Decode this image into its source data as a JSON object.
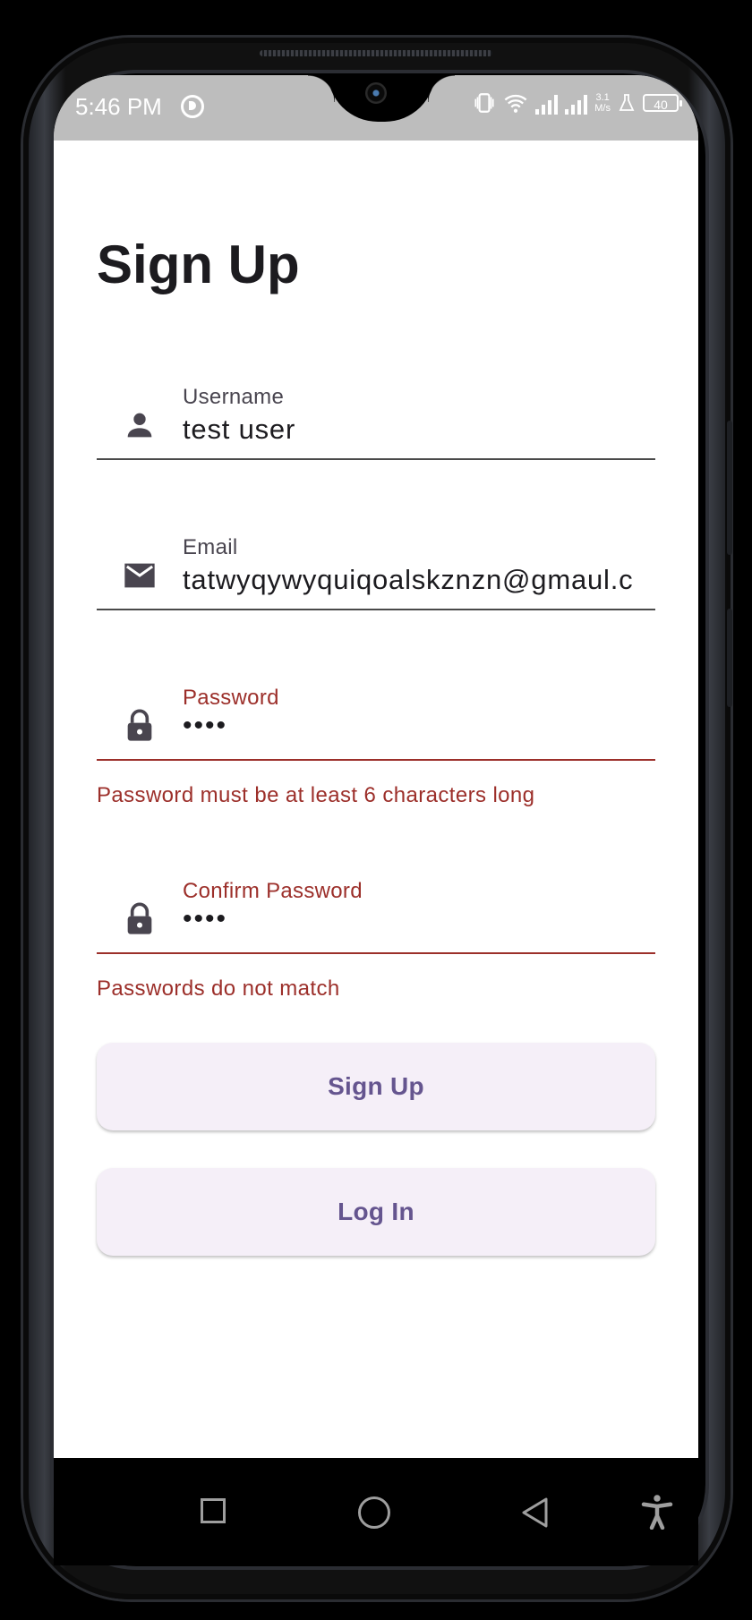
{
  "status_bar": {
    "time": "5:46 PM",
    "speed_top": "3.1",
    "speed_bottom": "M/s",
    "battery": "40"
  },
  "page": {
    "title": "Sign Up"
  },
  "form": {
    "username": {
      "label": "Username",
      "value": "test user",
      "icon": "person-icon"
    },
    "email": {
      "label": "Email",
      "value": "tatwyqywyquiqoalskznzn@gmaul.c",
      "icon": "mail-icon"
    },
    "password": {
      "label": "Password",
      "value": "••••",
      "icon": "lock-icon",
      "error": "Password must be at least 6 characters long"
    },
    "confirm_password": {
      "label": "Confirm Password",
      "value": "••••",
      "icon": "lock-icon",
      "error": "Passwords do not match"
    }
  },
  "buttons": {
    "sign_up": "Sign Up",
    "log_in": "Log In"
  },
  "colors": {
    "error": "#9c2f2a",
    "button_bg": "#f5eff8",
    "button_text": "#65558f",
    "status_bar": "#bdbdbd"
  },
  "nav_bar": {
    "icons": [
      "recents-square-icon",
      "home-circle-icon",
      "back-triangle-icon",
      "accessibility-icon"
    ]
  }
}
